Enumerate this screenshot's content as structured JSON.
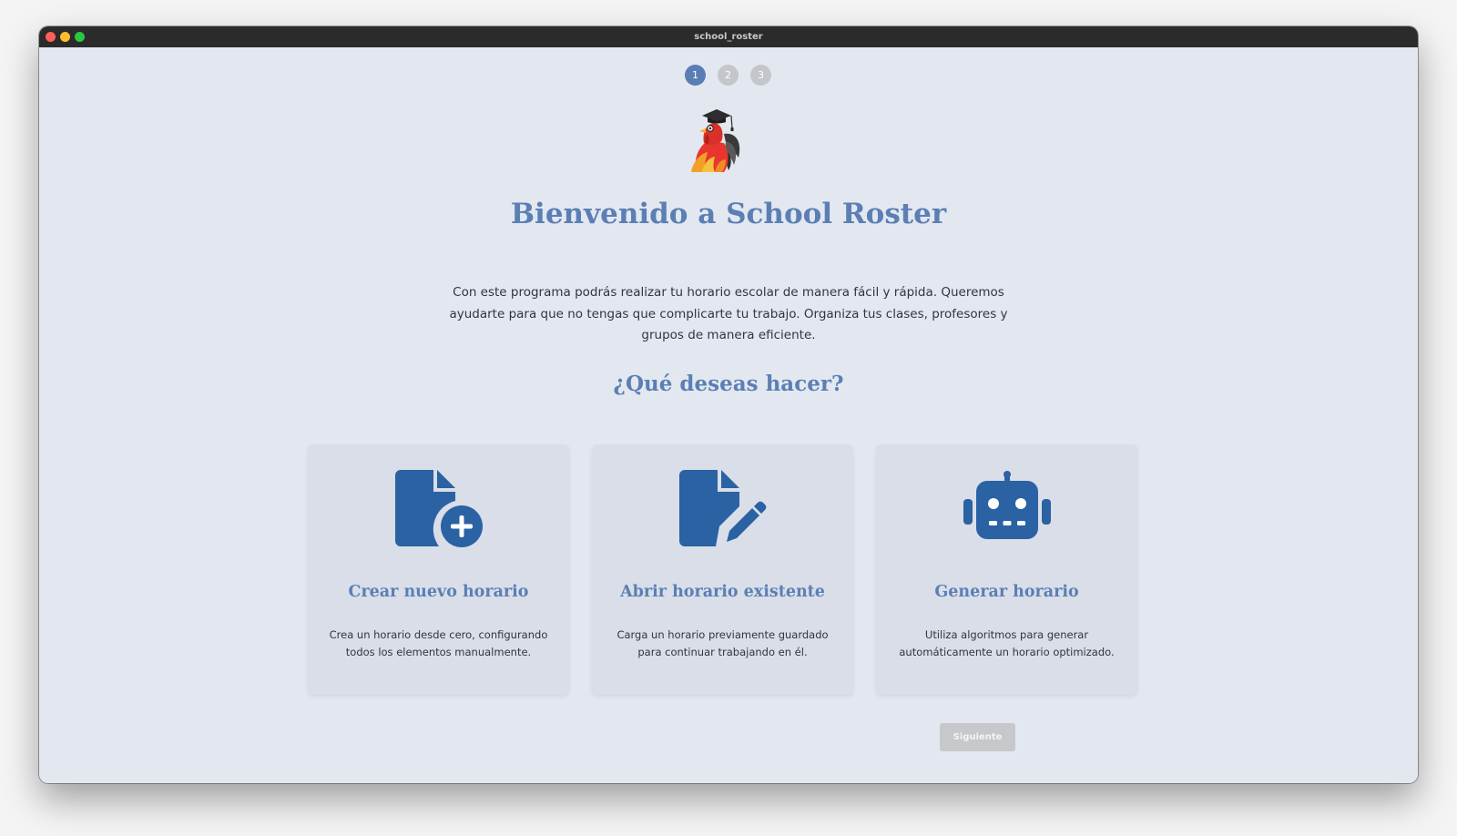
{
  "window": {
    "title": "school_roster"
  },
  "steps": [
    "1",
    "2",
    "3"
  ],
  "welcome": {
    "title": "Bienvenido a School Roster",
    "description": "Con este programa podrás realizar tu horario escolar de manera fácil y rápida. Queremos ayudarte para que no tengas que complicarte tu trabajo. Organiza tus clases, profesores y grupos de manera eficiente."
  },
  "question": "¿Qué deseas hacer?",
  "cards": [
    {
      "icon": "file-plus-icon",
      "title": "Crear nuevo horario",
      "description": "Crea un horario desde cero, configurando todos los elementos manualmente."
    },
    {
      "icon": "file-edit-icon",
      "title": "Abrir horario existente",
      "description": "Carga un horario previamente guardado para continuar trabajando en él."
    },
    {
      "icon": "robot-icon",
      "title": "Generar horario",
      "description": "Utiliza algoritmos para generar automáticamente un horario optimizado."
    }
  ],
  "next_button": {
    "label": "Siguiente",
    "disabled": true
  },
  "colors": {
    "accent": "#5b7fb5",
    "icon": "#2a62a3",
    "step_active": "#5a7db4",
    "step_inactive": "#c4c6cb",
    "background": "#e3e8f0",
    "card": "#d9dee8",
    "button_disabled": "#c6c8cc"
  }
}
